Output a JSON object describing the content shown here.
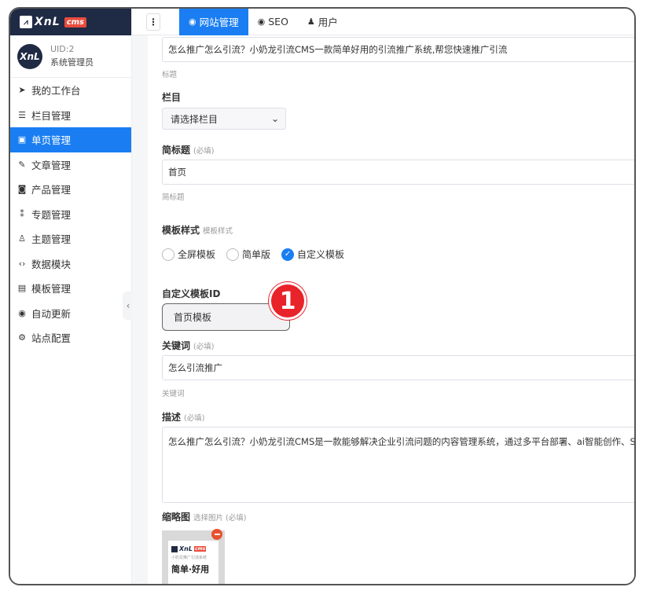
{
  "brand": {
    "name": "XnL",
    "badge": "cms"
  },
  "user": {
    "avatar_text": "XnL",
    "uid": "UID:2",
    "role": "系统管理员"
  },
  "sidebar": {
    "items": [
      {
        "label": "我的工作台",
        "icon": "rocket-icon"
      },
      {
        "label": "栏目管理",
        "icon": "list-icon"
      },
      {
        "label": "单页管理",
        "icon": "page-icon",
        "active": true
      },
      {
        "label": "文章管理",
        "icon": "pen-icon"
      },
      {
        "label": "产品管理",
        "icon": "product-icon"
      },
      {
        "label": "专题管理",
        "icon": "topic-icon"
      },
      {
        "label": "主题管理",
        "icon": "theme-icon"
      },
      {
        "label": "数据模块",
        "icon": "code-icon"
      },
      {
        "label": "模板管理",
        "icon": "template-icon"
      },
      {
        "label": "自动更新",
        "icon": "update-icon"
      },
      {
        "label": "站点配置",
        "icon": "config-icon"
      }
    ]
  },
  "topbar": {
    "tabs": [
      {
        "label": "网站管理",
        "active": true
      },
      {
        "label": "SEO"
      },
      {
        "label": "用户"
      }
    ]
  },
  "form": {
    "title_value": "怎么推广怎么引流？小奶龙引流CMS一款简单好用的引流推广系统,帮您快速推广引流",
    "title_hint": "标题",
    "category_label": "栏目",
    "category_selected": "请选择栏目",
    "short_title_label": "简标题",
    "short_title_required": "(必填)",
    "short_title_value": "首页",
    "short_title_hint": "简标题",
    "template_style_label": "模板样式",
    "template_style_sub": "模板样式",
    "template_options": [
      "全屏模板",
      "简单版",
      "自定义模板"
    ],
    "template_selected": "自定义模板",
    "custom_template_label": "自定义模板ID",
    "custom_template_value": "首页模板",
    "step_badge": "1",
    "keywords_label": "关键词",
    "keywords_required": "(必填)",
    "keywords_value": "怎么引流推广",
    "keywords_hint": "关键词",
    "desc_label": "描述",
    "desc_required": "(必填)",
    "desc_value": "怎么推广怎么引流？小奶龙引流CMS是一款能够解决企业引流问题的内容管理系统，通过多平台部署、ai智能创作、SEO收",
    "thumb_label": "缩略图",
    "thumb_sub": "选择图片 (必填)",
    "thumb_brand": "XnL",
    "thumb_badge": "cms",
    "thumb_slogan": "小奶龙推广引流系统",
    "thumb_big": "简单·好用"
  }
}
